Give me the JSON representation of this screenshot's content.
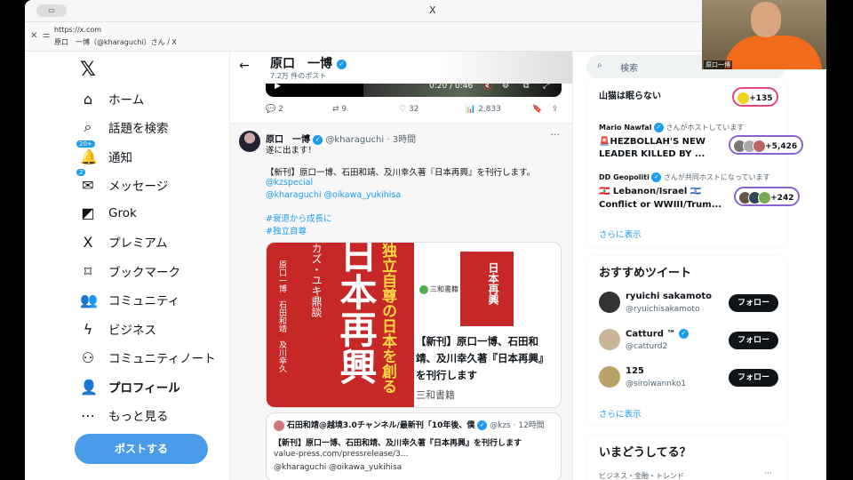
{
  "window": {
    "title": "X",
    "tab_icon": "▭"
  },
  "urlbar": {
    "url": "https://x.com",
    "page_title": "原口　一博（@kharaguchi）さん / X"
  },
  "nav": {
    "items": [
      {
        "icon": "⌂",
        "label": "ホーム"
      },
      {
        "icon": "⌕",
        "label": "話題を検索"
      },
      {
        "icon": "🔔",
        "label": "通知",
        "badge": "20+"
      },
      {
        "icon": "✉",
        "label": "メッセージ",
        "badge": "2"
      },
      {
        "icon": "◩",
        "label": "Grok"
      },
      {
        "icon": "X",
        "label": "プレミアム"
      },
      {
        "icon": "⌑",
        "label": "ブックマーク"
      },
      {
        "icon": "👥",
        "label": "コミュニティ"
      },
      {
        "icon": "ϟ",
        "label": "ビジネス"
      },
      {
        "icon": "⚇",
        "label": "コミュニティノート"
      },
      {
        "icon": "👤",
        "label": "プロフィール"
      },
      {
        "icon": "⋯",
        "label": "もっと見る"
      }
    ],
    "post_button": "ポストする"
  },
  "header": {
    "name": "原口　一博",
    "post_count": "7.2万 件のポスト"
  },
  "video": {
    "time": "0:20 / 0:46"
  },
  "prev_actions": {
    "replies": "2",
    "reposts": "9",
    "likes": "32",
    "views": "2,833"
  },
  "tweet": {
    "name": "原口　一博",
    "handle": "@kharaguchi",
    "time": "· 3時間",
    "lines": [
      "遂に出ます！",
      "【新刊】原口一博、石田和靖、及川幸久著『日本再興』を刊行します。"
    ],
    "mentions": [
      "@kzspecial",
      "@kharaguchi @oikawa_yukihisa"
    ],
    "hashtags": [
      "#衰退から成長に",
      "#独立自尊"
    ],
    "card": {
      "cover_title": "日本再興",
      "cover_tagline": "独立自尊の日本を創る",
      "cover_sub": "カズ・ユキ鼎談",
      "cover_authors": "原口一博　石田和靖　及川幸久",
      "publisher": "三和書籍",
      "title": "【新刊】原口一博、石田和靖、及川幸久著『日本再興』を刊行します",
      "footer": "三和書籍"
    },
    "quote": {
      "author": "石田和靖@越境3.0チャンネル/最新刊「10年後、僕",
      "handle": "@kzs",
      "time": "· 12時間",
      "text": "【新刊】原口一博、石田和靖、及川幸久著『日本再興』を刊行します",
      "link": "value-press.com/pressrelease/3...",
      "mentions": "@kharaguchi @oikawa_yukihisa"
    }
  },
  "right": {
    "search_placeholder": "検索",
    "spaces": [
      {
        "title": "山猫は眠らない",
        "count": "+135"
      },
      {
        "host": "Mario Nawfal",
        "host_text": "さんがホストしています",
        "title1": "🚨HEZBOLLAH'S NEW",
        "title2": "LEADER KILLED BY ...",
        "count": "+5,426"
      },
      {
        "host": "DD Geopoliti",
        "host_text": "さんが共同ホストになっています",
        "title1": "🇱🇧 Lebanon/Israel 🇮🇱",
        "title2": "Conflict or WWIII/Trum...",
        "count": "+242"
      }
    ],
    "show_more": "さらに表示",
    "recommend_title": "おすすめツイート",
    "recommend": [
      {
        "name": "ryuichi sakamoto",
        "handle": "@ryuichisakamoto",
        "button": "フォロー"
      },
      {
        "name": "Catturd ™",
        "handle": "@catturd2",
        "button": "フォロー"
      },
      {
        "name": "125",
        "handle": "@siroiwannko1",
        "button": "フォロー"
      }
    ],
    "trends_title": "いまどうしてる？",
    "trend_category": "ビジネス・金融・トレンド"
  },
  "webcam": {
    "label": "原口一博"
  }
}
